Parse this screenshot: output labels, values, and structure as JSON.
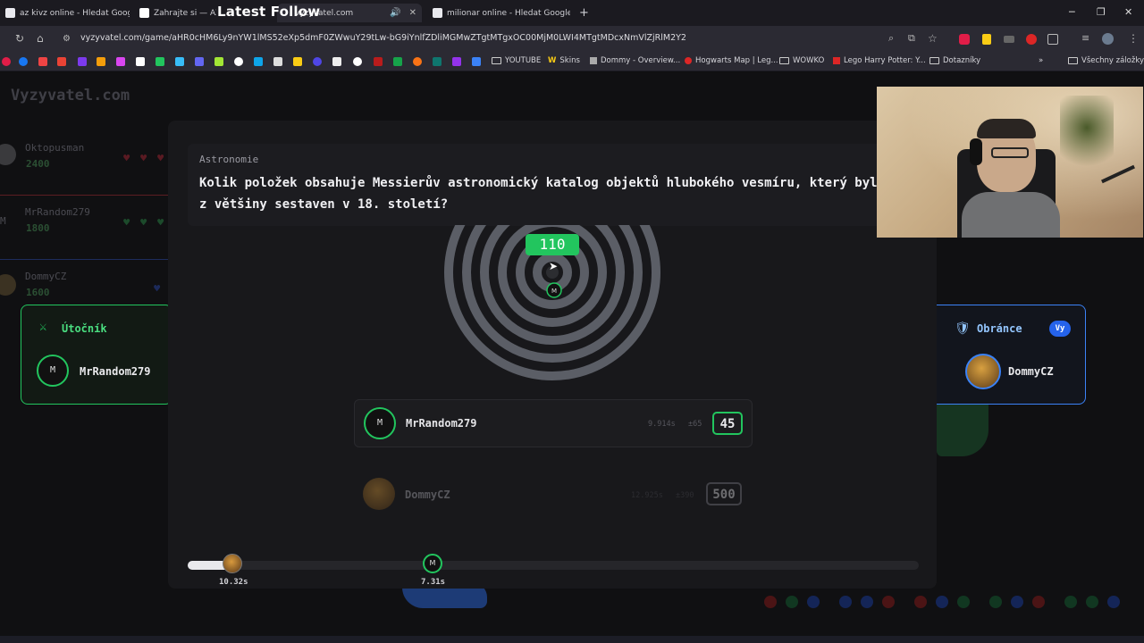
{
  "browser": {
    "tabs": [
      {
        "title": "az kivz online - Hledat Googlem",
        "active": false
      },
      {
        "title": "Zahrajte si — AZ-kv",
        "active": false
      },
      {
        "title": "vyzyvatel.com",
        "active": true
      },
      {
        "title": "milionar online - Hledat Googlem",
        "active": false
      }
    ],
    "overlay_title": "Latest Follow",
    "url": "vyzyvatel.com/game/aHR0cHM6Ly9nYW1lMS52eXp5dmF0ZWwuY29tLw-bG9iYnlfZDliMGMwZTgtMTgxOC00MjM0LWI4MTgtMDcxNmVlZjRlM2Y2",
    "bookmarks": [
      {
        "label": "YOUTUBE",
        "icon": "folder-icon"
      },
      {
        "label": "Skins",
        "icon": "w-icon"
      },
      {
        "label": "Dommy - Overview...",
        "icon": "page-icon"
      },
      {
        "label": "Hogwarts Map | Leg...",
        "icon": "page-icon"
      },
      {
        "label": "WOWKO",
        "icon": "folder-icon"
      },
      {
        "label": "Lego Harry Potter: Y...",
        "icon": "page-icon"
      },
      {
        "label": "Dotazníky",
        "icon": "folder-icon"
      },
      {
        "label": "Všechny záložky",
        "icon": "folder-icon"
      }
    ]
  },
  "page": {
    "site_logo": "Vyzyvatel.com",
    "players": [
      {
        "name": "Oktopusman",
        "score": "2400"
      },
      {
        "name": "MrRandom279",
        "score": "1800"
      },
      {
        "name": "DommyCZ",
        "score": "1600"
      }
    ],
    "attacker": {
      "label": "Útočník",
      "name": "MrRandom279",
      "initial": "M"
    },
    "defender": {
      "label": "Obránce",
      "name": "DommyCZ",
      "you_badge": "Vy"
    },
    "question": {
      "category": "Astronomie",
      "text": "Kolik položek obsahuje Messierův astronomický katalog objektů hlubokého vesmíru, který byl z většiny sestaven v 18. století?"
    },
    "correct_answer": "110",
    "answers": [
      {
        "initial": "M",
        "name": "MrRandom279",
        "time": "9.914s",
        "diff": "±65",
        "value": "45"
      },
      {
        "name": "DommyCZ",
        "time": "12.925s",
        "diff": "±390",
        "value": "500"
      }
    ],
    "timeline": [
      {
        "label": "10.32s"
      },
      {
        "initial": "M",
        "label": "7.31s"
      }
    ],
    "colors": {
      "accent_green": "#22c55e",
      "accent_blue": "#3b82f6"
    }
  }
}
